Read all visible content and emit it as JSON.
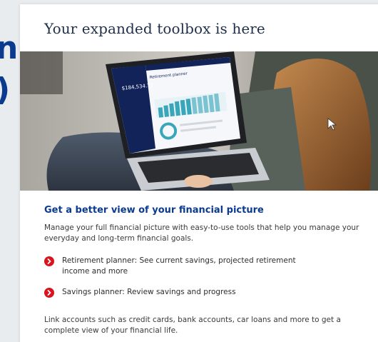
{
  "background": {
    "line1": "n",
    "line2": ")"
  },
  "card": {
    "title": "Your expanded toolbox is here"
  },
  "hero": {
    "screen_title": "Retirement planner",
    "screen_balance": "$184,534.71"
  },
  "section": {
    "heading": "Get a better view of your financial picture",
    "description": "Manage your full financial picture with easy-to-use tools that help you manage your everyday and long-term financial goals.",
    "bullets": [
      {
        "text": "Retirement planner: See current savings, projected retirement income and more"
      },
      {
        "text": "Savings planner: Review savings and progress"
      }
    ],
    "footer": "Link accounts such as credit cards, bank accounts, car loans and more to get a complete view of your financial life."
  },
  "colors": {
    "brand_blue": "#0b3b8f",
    "bullet_red": "#d9141e",
    "title_navy": "#1f2f4a"
  },
  "icons": {
    "bullet": "chevron-right-circle-icon",
    "cursor": "mouse-pointer-icon"
  }
}
